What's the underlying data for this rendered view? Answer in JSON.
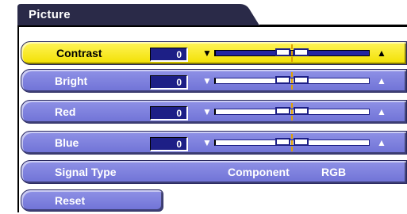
{
  "menu": {
    "title": "Picture",
    "accent_color": "#f2e000",
    "bar_color": "#7b7ed9",
    "rows": [
      {
        "label": "Contrast",
        "value": "0",
        "level": 0.5,
        "selected": true
      },
      {
        "label": "Bright",
        "value": "0",
        "level": 0.5,
        "selected": false
      },
      {
        "label": "Red",
        "value": "0",
        "level": 0.5,
        "selected": false
      },
      {
        "label": "Blue",
        "value": "0",
        "level": 0.5,
        "selected": false
      }
    ],
    "signal_type": {
      "label": "Signal Type",
      "option1": "Component",
      "option2": "RGB"
    },
    "reset": {
      "label": "Reset"
    },
    "icons": {
      "decrease": "down-triangle-icon",
      "increase": "up-triangle-icon"
    },
    "glyphs": {
      "down": "▼",
      "up": "▲"
    }
  }
}
